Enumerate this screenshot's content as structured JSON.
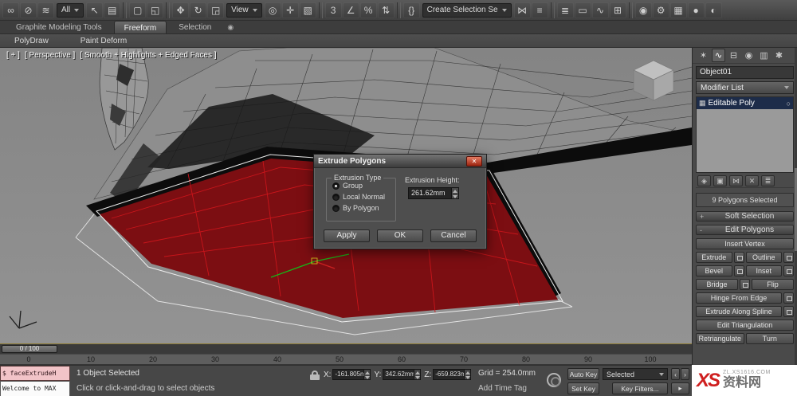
{
  "toolbar": {
    "items": [
      {
        "type": "icon",
        "name": "select-and-link-icon",
        "glyph": "∞"
      },
      {
        "type": "icon",
        "name": "unlink-selection-icon",
        "glyph": "⊘"
      },
      {
        "type": "icon",
        "name": "bind-to-space-warp-icon",
        "glyph": "≋"
      },
      {
        "type": "dropdown",
        "name": "selection-filter-dropdown",
        "label": "All"
      },
      {
        "type": "icon",
        "name": "select-object-icon",
        "glyph": "↖"
      },
      {
        "type": "icon",
        "name": "select-by-name-icon",
        "glyph": "▤"
      },
      {
        "type": "sep"
      },
      {
        "type": "icon",
        "name": "rectangular-selection-icon",
        "glyph": "▢"
      },
      {
        "type": "icon",
        "name": "window-crossing-icon",
        "glyph": "◱"
      },
      {
        "type": "sep"
      },
      {
        "type": "icon",
        "name": "select-and-move-icon",
        "glyph": "✥"
      },
      {
        "type": "icon",
        "name": "select-and-rotate-icon",
        "glyph": "↻"
      },
      {
        "type": "icon",
        "name": "select-and-scale-icon",
        "glyph": "◲"
      },
      {
        "type": "dropdown",
        "name": "reference-coordinate-dropdown",
        "label": "View"
      },
      {
        "type": "icon",
        "name": "use-pivot-center-icon",
        "glyph": "◎"
      },
      {
        "type": "icon",
        "name": "select-and-manipulate-icon",
        "glyph": "✛"
      },
      {
        "type": "icon",
        "name": "keyboard-shortcut-override-icon",
        "glyph": "▧"
      },
      {
        "type": "sep"
      },
      {
        "type": "icon",
        "name": "snaps-toggle-icon",
        "glyph": "3"
      },
      {
        "type": "icon",
        "name": "angle-snap-icon",
        "glyph": "∠"
      },
      {
        "type": "icon",
        "name": "percent-snap-icon",
        "glyph": "%"
      },
      {
        "type": "icon",
        "name": "spinner-snap-icon",
        "glyph": "⇅"
      },
      {
        "type": "sep"
      },
      {
        "type": "icon",
        "name": "edit-named-selection-sets-icon",
        "glyph": "{}"
      },
      {
        "type": "dropdown",
        "name": "named-selection-set-dropdown",
        "label": "Create Selection Se"
      },
      {
        "type": "icon",
        "name": "mirror-icon",
        "glyph": "⋈"
      },
      {
        "type": "icon",
        "name": "align-icon",
        "glyph": "≡"
      },
      {
        "type": "sep"
      },
      {
        "type": "icon",
        "name": "layer-manager-icon",
        "glyph": "≣"
      },
      {
        "type": "icon",
        "name": "graphite-ribbon-toggle-icon",
        "glyph": "▭"
      },
      {
        "type": "icon",
        "name": "curve-editor-icon",
        "glyph": "∿"
      },
      {
        "type": "icon",
        "name": "schematic-view-icon",
        "glyph": "⊞"
      },
      {
        "type": "sep"
      },
      {
        "type": "icon",
        "name": "material-editor-icon",
        "glyph": "◉"
      },
      {
        "type": "icon",
        "name": "render-setup-icon",
        "glyph": "⚙"
      },
      {
        "type": "icon",
        "name": "rendered-frame-icon",
        "glyph": "▦"
      },
      {
        "type": "icon",
        "name": "render-production-icon",
        "glyph": "●"
      },
      {
        "type": "icon",
        "name": "render-iterative-icon",
        "glyph": "◐"
      }
    ]
  },
  "ribbon": {
    "tabs": [
      {
        "label": "Graphite Modeling Tools",
        "active": false
      },
      {
        "label": "Freeform",
        "active": true
      },
      {
        "label": "Selection",
        "active": false
      }
    ],
    "extra_icon": "◉",
    "sub_tabs": [
      "PolyDraw",
      "Paint Deform"
    ]
  },
  "viewport": {
    "labels": [
      "[ + ]",
      "[ Perspective ]",
      "[ Smooth + Highlights + Edged Faces ]"
    ]
  },
  "dialog": {
    "title": "Extrude Polygons",
    "close_glyph": "✕",
    "group_title": "Extrusion Type",
    "radios": [
      {
        "label": "Group",
        "selected": true
      },
      {
        "label": "Local Normal",
        "selected": false
      },
      {
        "label": "By Polygon",
        "selected": false
      }
    ],
    "height_label": "Extrusion Height:",
    "height_value": "261.62mm",
    "buttons": [
      "Apply",
      "OK",
      "Cancel"
    ]
  },
  "command_panel": {
    "tabs": [
      {
        "name": "create-tab-icon",
        "glyph": "✶",
        "active": false
      },
      {
        "name": "modify-tab-icon",
        "glyph": "∿",
        "active": true
      },
      {
        "name": "hierarchy-tab-icon",
        "glyph": "⊟",
        "active": false
      },
      {
        "name": "motion-tab-icon",
        "glyph": "◉",
        "active": false
      },
      {
        "name": "display-tab-icon",
        "glyph": "▥",
        "active": false
      },
      {
        "name": "utilities-tab-icon",
        "glyph": "✱",
        "active": false
      }
    ],
    "object_name": "Object01",
    "modifier_list_label": "Modifier List",
    "stack_items": [
      {
        "label": "Editable Poly",
        "selected": true,
        "icon": "▦",
        "bulb": "○"
      }
    ],
    "stack_tools": [
      {
        "name": "pin-stack-icon",
        "glyph": "◈"
      },
      {
        "name": "show-end-result-icon",
        "glyph": "▣"
      },
      {
        "name": "make-unique-icon",
        "glyph": "⋈"
      },
      {
        "name": "remove-modifier-icon",
        "glyph": "✕"
      },
      {
        "name": "configure-modifier-sets-icon",
        "glyph": "≣"
      }
    ],
    "selection_info": "9 Polygons Selected",
    "rollouts": [
      {
        "label": "Soft Selection",
        "state": "+"
      },
      {
        "label": "Edit Polygons",
        "state": "-"
      }
    ],
    "edit_polygons_rows": [
      [
        {
          "label": "Insert Vertex",
          "settings": false
        }
      ],
      [
        {
          "label": "Extrude",
          "settings": true
        },
        {
          "label": "Outline",
          "settings": true
        }
      ],
      [
        {
          "label": "Bevel",
          "settings": true
        },
        {
          "label": "Inset",
          "settings": true
        }
      ],
      [
        {
          "label": "Bridge",
          "settings": true
        },
        {
          "label": "Flip",
          "settings": false
        }
      ],
      [
        {
          "label": "Hinge From Edge",
          "settings": true
        }
      ],
      [
        {
          "label": "Extrude Along Spline",
          "settings": true
        }
      ],
      [
        {
          "label": "Edit Triangulation",
          "settings": false
        }
      ],
      [
        {
          "label": "Retriangulate",
          "settings": false
        },
        {
          "label": "Turn",
          "settings": false
        }
      ]
    ]
  },
  "timeline": {
    "slider_label": "0 / 100",
    "ticks": [
      "0",
      "10",
      "20",
      "30",
      "40",
      "50",
      "60",
      "70",
      "80",
      "90",
      "100"
    ]
  },
  "status_bar": {
    "listener_line1": "$ faceExtrudeH",
    "listener_line2": "Welcome to MAX",
    "selection_status": "1 Object Selected",
    "prompt": "Click or click-and-drag to select objects",
    "coords": [
      {
        "label": "X:",
        "value": "-161.805m"
      },
      {
        "label": "Y:",
        "value": "342.62mm"
      },
      {
        "label": "Z:",
        "value": "-659.823m"
      }
    ],
    "grid_label": "Grid = 254.0mm",
    "add_time_tag": "Add Time Tag",
    "auto_key": "Auto Key",
    "set_key": "Set Key",
    "selected_dropdown": "Selected",
    "key_filters": "Key Filters...",
    "key_nav": [
      {
        "name": "previous-key-button",
        "glyph": "‹"
      },
      {
        "name": "next-key-button",
        "glyph": "›"
      },
      {
        "name": "play-animation-button",
        "glyph": "▸"
      }
    ]
  },
  "watermark": {
    "logo": "XS",
    "site": "资料网",
    "url": "ZL.XS1616.COM"
  },
  "colors": {
    "selected_polygons_red": "#7c0e12",
    "wireframe_red": "#c9151b",
    "stack_selected_blue": "#1d2c49",
    "listener_pink": "#f2c4c8",
    "watermark_red": "#cf1f1f"
  }
}
